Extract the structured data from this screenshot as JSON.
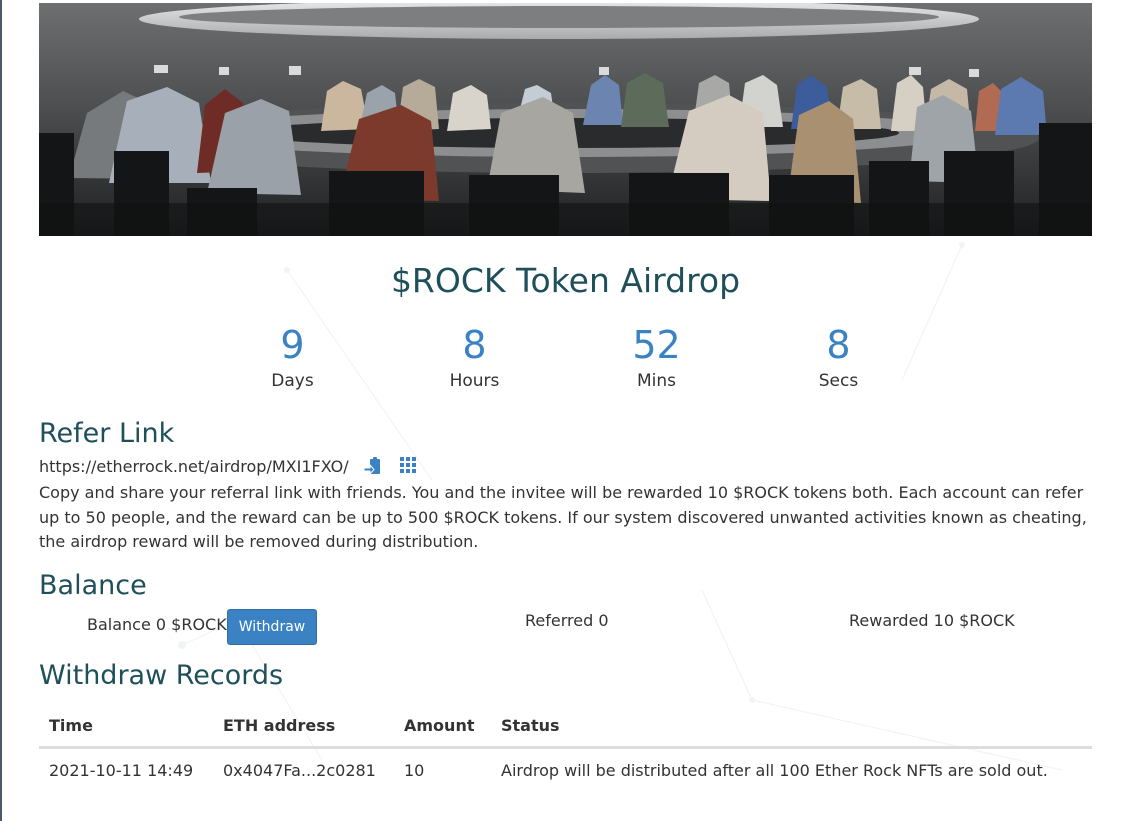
{
  "banner": {
    "alt": "Ether Rock council round table illustration"
  },
  "title": "$ROCK Token Airdrop",
  "countdown": [
    {
      "value": "9",
      "label": "Days"
    },
    {
      "value": "8",
      "label": "Hours"
    },
    {
      "value": "52",
      "label": "Mins"
    },
    {
      "value": "8",
      "label": "Secs"
    }
  ],
  "refer": {
    "heading": "Refer Link",
    "url": "https://etherrock.net/airdrop/MXI1FXO/",
    "copy_icon": "clipboard-icon",
    "qr_icon": "qr-code-icon",
    "description": "Copy and share your referral link with friends. You and the invitee will be rewarded 10 $ROCK tokens both. Each account can refer up to 50 people, and the reward can be up to 500 $ROCK tokens. If our system discovered unwanted activities known as cheating, the airdrop reward will be removed during distribution."
  },
  "balance": {
    "heading": "Balance",
    "balance_text": "Balance 0 $ROCK",
    "withdraw_label": "Withdraw",
    "referred_text": "Referred 0",
    "rewarded_text": "Rewarded 10 $ROCK"
  },
  "records": {
    "heading": "Withdraw Records",
    "columns": [
      "Time",
      "ETH address",
      "Amount",
      "Status"
    ],
    "rows": [
      [
        "2021-10-11 14:49",
        "0x4047Fa...2c0281",
        "10",
        "Airdrop will be distributed after all 100 Ether Rock NFTs are sold out."
      ]
    ]
  },
  "colors": {
    "accent": "#3a82c4",
    "heading": "#1e4f5a"
  }
}
